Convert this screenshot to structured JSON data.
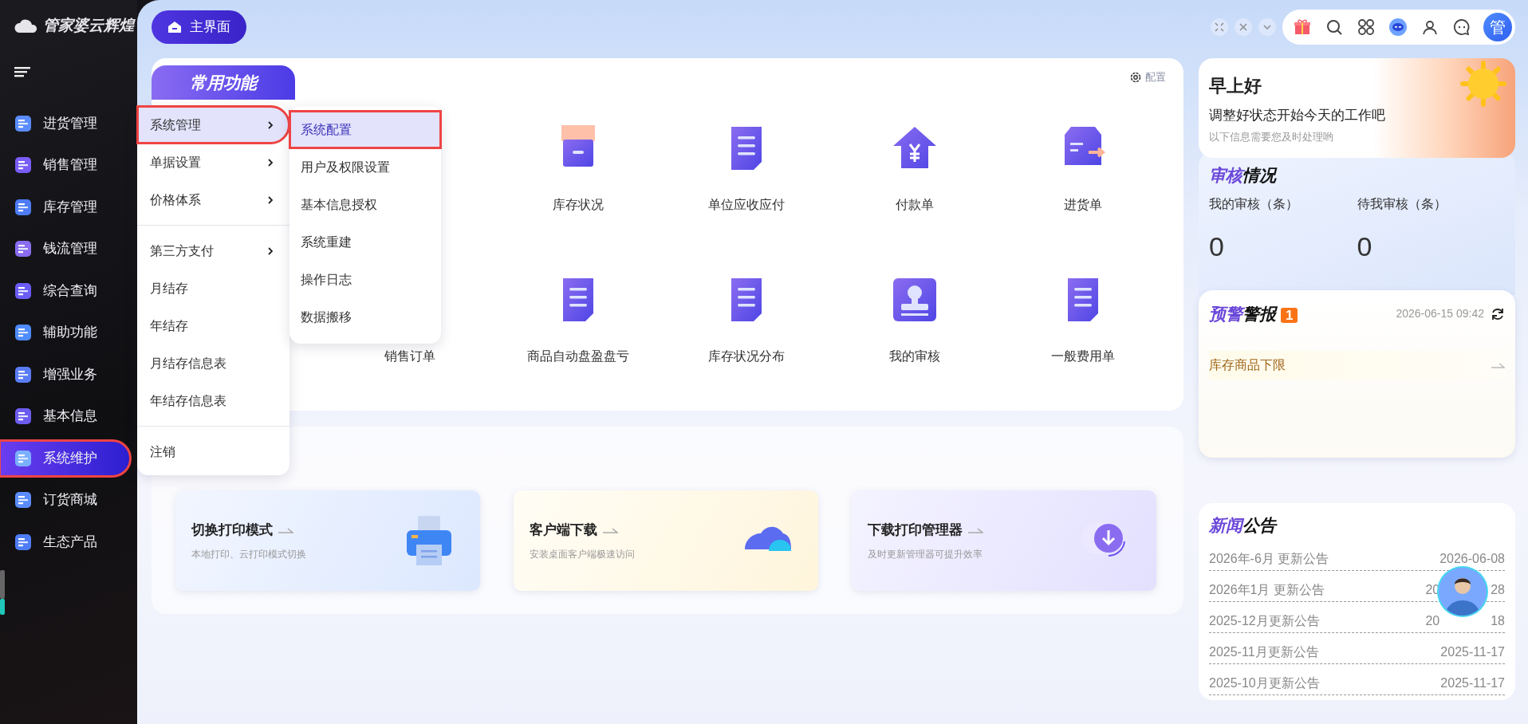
{
  "logo": {
    "text": "管家婆云辉煌"
  },
  "sidebar": {
    "items": [
      {
        "label": "进货管理",
        "selected": false,
        "highlighted": false
      },
      {
        "label": "销售管理",
        "selected": false,
        "highlighted": false
      },
      {
        "label": "库存管理",
        "selected": false,
        "highlighted": false
      },
      {
        "label": "钱流管理",
        "selected": false,
        "highlighted": false
      },
      {
        "label": "综合查询",
        "selected": false,
        "highlighted": false
      },
      {
        "label": "辅助功能",
        "selected": false,
        "highlighted": false
      },
      {
        "label": "增强业务",
        "selected": false,
        "highlighted": false
      },
      {
        "label": "基本信息",
        "selected": false,
        "highlighted": false
      },
      {
        "label": "系统维护",
        "selected": true,
        "highlighted": true
      },
      {
        "label": "订货商城",
        "selected": false,
        "highlighted": false
      },
      {
        "label": "生态产品",
        "selected": false,
        "highlighted": false
      }
    ]
  },
  "home_button": {
    "label": "主界面"
  },
  "user": {
    "initial": "管"
  },
  "common_functions": {
    "title": "常用功能",
    "config_label": "配置",
    "rows": [
      {
        "items": [
          {
            "label": "库存状况",
            "kind": "box"
          },
          {
            "label": "单位应收应付",
            "kind": "doc"
          },
          {
            "label": "付款单",
            "kind": "house"
          },
          {
            "label": "进货单",
            "kind": "inbox"
          }
        ]
      },
      {
        "items": [
          {
            "label": "销售订单"
          },
          {
            "label": "商品自动盘盈盘亏",
            "kind": "doc"
          },
          {
            "label": "库存状况分布",
            "kind": "doc"
          },
          {
            "label": "我的审核",
            "kind": "stamp"
          },
          {
            "label": "一般费用单",
            "kind": "doc"
          }
        ]
      }
    ]
  },
  "shortcuts": [
    {
      "title": "切换打印模式",
      "subtitle": "本地打印、云打印模式切换",
      "kind": "printer"
    },
    {
      "title": "客户端下载",
      "subtitle": "安装桌面客户端极速访问",
      "kind": "cloud"
    },
    {
      "title": "下载打印管理器",
      "subtitle": "及时更新管理器可提升效率",
      "kind": "download"
    }
  ],
  "menu": {
    "groups": [
      [
        {
          "label": "系统管理",
          "has_submenu": true,
          "selected": true,
          "highlighted": true
        },
        {
          "label": "单据设置",
          "has_submenu": true,
          "selected": false,
          "highlighted": false
        },
        {
          "label": "价格体系",
          "has_submenu": true,
          "selected": false,
          "highlighted": false
        }
      ],
      [
        {
          "label": "第三方支付",
          "has_submenu": true,
          "selected": false,
          "highlighted": false
        },
        {
          "label": "月结存",
          "has_submenu": false,
          "selected": false,
          "highlighted": false
        },
        {
          "label": "年结存",
          "has_submenu": false,
          "selected": false,
          "highlighted": false
        },
        {
          "label": "月结存信息表",
          "has_submenu": false,
          "selected": false,
          "highlighted": false
        },
        {
          "label": "年结存信息表",
          "has_submenu": false,
          "selected": false,
          "highlighted": false
        }
      ],
      [
        {
          "label": "注销",
          "has_submenu": false,
          "selected": false,
          "highlighted": false
        }
      ]
    ]
  },
  "submenu": {
    "items": [
      {
        "label": "系统配置",
        "selected": true,
        "highlighted": true
      },
      {
        "label": "用户及权限设置",
        "selected": false,
        "highlighted": false
      },
      {
        "label": "基本信息授权",
        "selected": false,
        "highlighted": false
      },
      {
        "label": "系统重建",
        "selected": false,
        "highlighted": false
      },
      {
        "label": "操作日志",
        "selected": false,
        "highlighted": false
      },
      {
        "label": "数据搬移",
        "selected": false,
        "highlighted": false
      }
    ]
  },
  "greeting": {
    "title": "早上好",
    "message": "调整好状态开始今天的工作吧",
    "hint": "以下信息需要您及时处理哟"
  },
  "review": {
    "title_accent": "审核",
    "title": "情况",
    "stats": [
      {
        "label": "我的审核（条）",
        "value": "0"
      },
      {
        "label": "待我审核（条）",
        "value": "0"
      }
    ]
  },
  "alerts": {
    "title_accent": "预警",
    "title": "警报",
    "count": "1",
    "time": "2026-06-15 09:42",
    "items": [
      {
        "label": "库存商品下限"
      }
    ]
  },
  "news": {
    "title_accent": "新闻",
    "title": "公告",
    "items": [
      {
        "title": "2026年-6月 更新公告",
        "date": "2026-06-08"
      },
      {
        "title": "2026年1月 更新公告",
        "date_start": "20",
        "date_end": "28"
      },
      {
        "title": "2025-12月更新公告",
        "date_start": "20",
        "date_end": "18"
      },
      {
        "title": "2025-11月更新公告",
        "date": "2025-11-17"
      },
      {
        "title": "2025-10月更新公告",
        "date": "2025-11-17"
      }
    ]
  }
}
